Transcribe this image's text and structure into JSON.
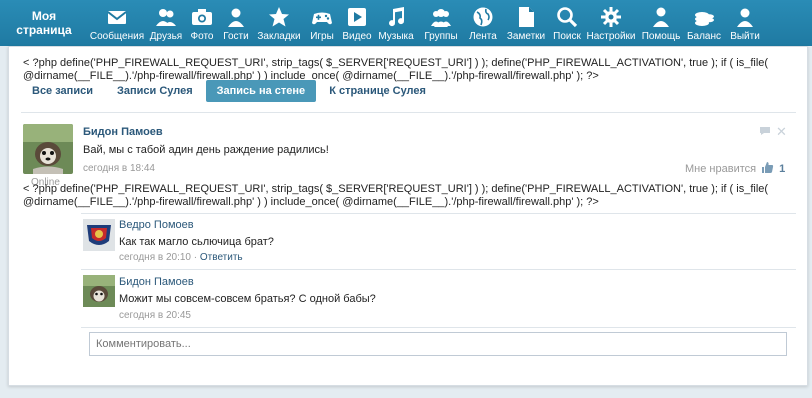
{
  "nav": {
    "home_label": "Моя\nстраница",
    "items": [
      {
        "icon": "envelope-icon",
        "label": "Сообщения"
      },
      {
        "icon": "friends-icon",
        "label": "Друзья"
      },
      {
        "icon": "camera-icon",
        "label": "Фото"
      },
      {
        "icon": "user-icon",
        "label": "Гости"
      },
      {
        "icon": "star-icon",
        "label": "Закладки"
      },
      {
        "icon": "gamepad-icon",
        "label": "Игры"
      },
      {
        "icon": "play-icon",
        "label": "Видео"
      },
      {
        "icon": "music-icon",
        "label": "Музыка"
      },
      {
        "icon": "group-icon",
        "label": "Группы"
      },
      {
        "icon": "globe-icon",
        "label": "Лента"
      },
      {
        "icon": "note-icon",
        "label": "Заметки"
      },
      {
        "icon": "search-icon",
        "label": "Поиск"
      },
      {
        "icon": "gear-icon",
        "label": "Настройки"
      },
      {
        "icon": "help-icon",
        "label": "Помощь"
      },
      {
        "icon": "coins-icon",
        "label": "Баланс"
      },
      {
        "icon": "logout-icon",
        "label": "Выйти"
      }
    ]
  },
  "php_line_1": "< ?php define('PHP_FIREWALL_REQUEST_URI', strip_tags( $_SERVER['REQUEST_URI'] ) ); define('PHP_FIREWALL_ACTIVATION', true ); if ( is_file( @dirname(__FILE__).'/php-firewall/firewall.php' ) ) include_once( @dirname(__FILE__).'/php-firewall/firewall.php' ); ?>",
  "php_line_2": "< ?php define('PHP_FIREWALL_REQUEST_URI', strip_tags( $_SERVER['REQUEST_URI'] ) ); define('PHP_FIREWALL_ACTIVATION', true ); if ( is_file( @dirname(__FILE__).'/php-firewall/firewall.php' ) ) include_once( @dirname(__FILE__).'/php-firewall/firewall.php' ); ?>",
  "tabs": [
    "Все записи",
    "Записи Сулея",
    "Запись на стене",
    "К странице Сулея"
  ],
  "post": {
    "author": "Бидон Памоев",
    "text": "Вай, мы с табой адин день раждение радились!",
    "time": "сегодня в 18:44",
    "like_label": "Мне нравится",
    "like_count": "1",
    "online": "Online"
  },
  "comments": [
    {
      "author": "Ведро Помоев",
      "text": "Как так магло сьлючица брат?",
      "time": "сегодня в 20:10",
      "reply": "Ответить"
    },
    {
      "author": "Бидон Памоев",
      "text": "Можит мы совсем-совсем братья? С одной бабы?",
      "time": "сегодня в 20:45"
    }
  ],
  "comment_placeholder": "Комментировать..."
}
